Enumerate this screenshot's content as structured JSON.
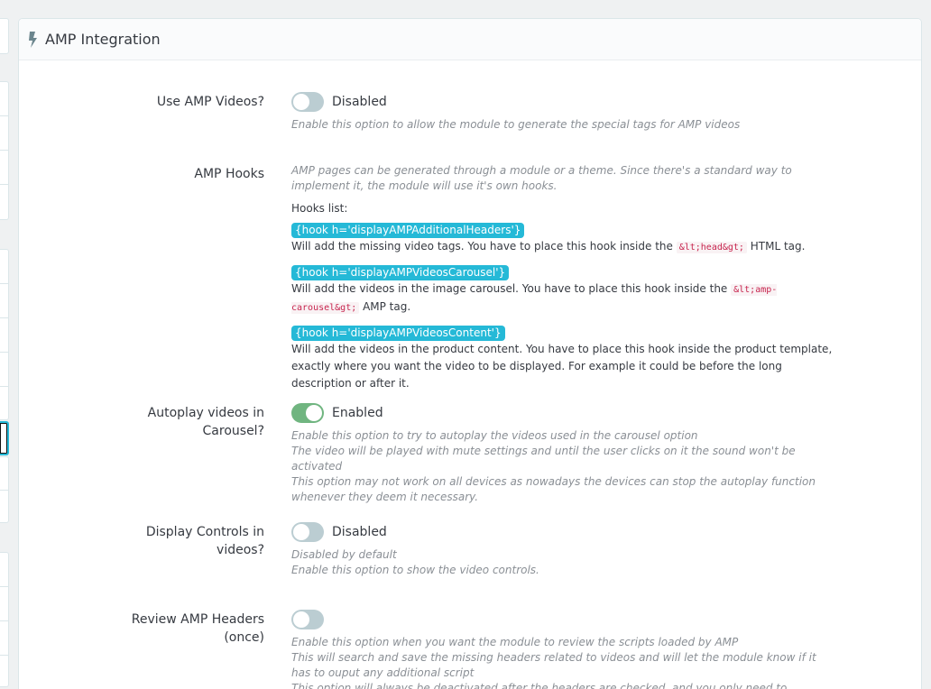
{
  "panel": {
    "title": "AMP Integration",
    "icon": "bolt-icon"
  },
  "fields": {
    "use_amp_videos": {
      "label": "Use AMP Videos?",
      "state": "Disabled",
      "help": "Enable this option to allow the module to generate the special tags for AMP videos"
    },
    "amp_hooks": {
      "label": "AMP Hooks",
      "intro": "AMP pages can be generated through a module or a theme. Since there's a standard way to implement it, the module will use it's own hooks.",
      "list_title": "Hooks list:",
      "hooks": [
        {
          "code": "{hook h='displayAMPAdditionalHeaders'}",
          "desc_before": "Will add the missing video tags. You have to place this hook inside the ",
          "tag": "&lt;head&gt;",
          "desc_after": " HTML tag."
        },
        {
          "code": "{hook h='displayAMPVideosCarousel'}",
          "desc_before": "Will add the videos in the image carousel. You have to place this hook inside the ",
          "tag": "&lt;amp-carousel&gt;",
          "desc_after": " AMP tag."
        },
        {
          "code": "{hook h='displayAMPVideosContent'}",
          "desc_before": "Will add the videos in the product content. You have to place this hook inside the product template, exactly where you want the video to be displayed. For example it could be before the long description or after it.",
          "tag": "",
          "desc_after": ""
        }
      ]
    },
    "autoplay": {
      "label": "Autoplay videos in Carousel?",
      "state": "Enabled",
      "help": [
        "Enable this option to try to autoplay the videos used in the carousel option",
        "The video will be played with mute settings and until the user clicks on it the sound won't be activated",
        "This option may not work on all devices as nowadays the devices can stop the autoplay function whenever they deem it necessary."
      ]
    },
    "display_controls": {
      "label": "Display Controls in videos?",
      "state": "Disabled",
      "help": [
        "Disabled by default",
        "Enable this option to show the video controls."
      ]
    },
    "review_headers": {
      "label": "Review AMP Headers (once)",
      "state": "",
      "help": [
        "Enable this option when you want the module to review the scripts loaded by AMP",
        "This will search and save the missing headers related to videos and will let the module know if it has to ouput any additional script",
        "This option will always be deactivated after the headers are checked, and you only need to activate it when you"
      ]
    }
  },
  "colors": {
    "accent": "#25b9d7",
    "switch_on": "#70b580",
    "switch_off": "#bbcdd2"
  }
}
